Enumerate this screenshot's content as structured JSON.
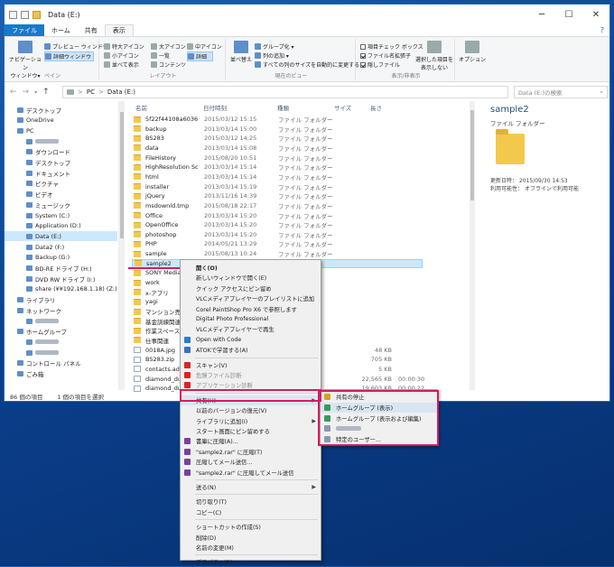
{
  "window": {
    "title": "Data (E:)",
    "controls": {
      "minimize": "─",
      "maximize": "☐",
      "close": "✕"
    }
  },
  "tabs": {
    "file": "ファイル",
    "home": "ホーム",
    "share": "共有",
    "view": "表示"
  },
  "ribbon": {
    "pane": {
      "nav_pane": "ナビゲーション\nウィンドウ▾",
      "preview_pane": "プレビュー ウィンドウ",
      "details_pane": "詳細ウィンドウ",
      "label": "ペイン"
    },
    "layout": {
      "xlarge_icons": "特大アイコン",
      "large_icons": "大アイコン",
      "medium_icons": "中アイコン",
      "small_icons": "小アイコン",
      "list": "一覧",
      "details": "詳細",
      "tiles": "並べて表示",
      "content": "コンテンツ",
      "label": "レイアウト"
    },
    "current_view": {
      "sort": "並べ替え",
      "group_by": "グループ化 ▾",
      "add_columns": "列の追加 ▾",
      "size_all_columns": "すべての列のサイズを自動的に変更する",
      "label": "現在のビュー"
    },
    "show_hide": {
      "item_checkboxes": "項目チェック ボックス",
      "file_extensions": "ファイル名拡張子",
      "hidden_items": "隠しファイル",
      "hide_selected": "選択した項目を\n表示しない",
      "label": "表示/非表示",
      "checked": {
        "item_checkboxes": false,
        "file_extensions": true,
        "hidden_items": true
      }
    },
    "options": "オプション"
  },
  "address": {
    "back": "←",
    "forward": "→",
    "recent": "▾",
    "up": "↑",
    "path": [
      "PC",
      "Data (E:)"
    ],
    "separator": ">",
    "search_placeholder": "Data (E:)の検索"
  },
  "nav": [
    {
      "label": "デスクトップ",
      "indent": 1,
      "icon": "desktop-icon"
    },
    {
      "label": "OneDrive",
      "indent": 1,
      "icon": "onedrive-icon"
    },
    {
      "label": "PC",
      "indent": 1,
      "icon": "pc-icon"
    },
    {
      "label": "",
      "indent": 2,
      "icon": "user-icon",
      "blurred": true
    },
    {
      "label": "ダウンロード",
      "indent": 2,
      "icon": "download-icon"
    },
    {
      "label": "デスクトップ",
      "indent": 2,
      "icon": "desktop-icon"
    },
    {
      "label": "ドキュメント",
      "indent": 2,
      "icon": "documents-icon"
    },
    {
      "label": "ピクチャ",
      "indent": 2,
      "icon": "pictures-icon"
    },
    {
      "label": "ビデオ",
      "indent": 2,
      "icon": "video-icon"
    },
    {
      "label": "ミュージック",
      "indent": 2,
      "icon": "music-icon"
    },
    {
      "label": "System (C:)",
      "indent": 2,
      "icon": "drive-icon"
    },
    {
      "label": "Application (D:)",
      "indent": 2,
      "icon": "drive-icon"
    },
    {
      "label": "Data (E:)",
      "indent": 2,
      "icon": "drive-icon",
      "selected": true
    },
    {
      "label": "Data2 (F:)",
      "indent": 2,
      "icon": "drive-icon"
    },
    {
      "label": "Backup (G:)",
      "indent": 2,
      "icon": "drive-icon"
    },
    {
      "label": "BD-RE ドライブ (H:)",
      "indent": 2,
      "icon": "disc-icon"
    },
    {
      "label": "DVD RW ドライブ (I:)",
      "indent": 2,
      "icon": "disc-icon"
    },
    {
      "label": "share (¥¥192.168.1.18) (Z:)",
      "indent": 2,
      "icon": "network-drive-icon"
    },
    {
      "label": "ライブラリ",
      "indent": 1,
      "icon": "library-icon"
    },
    {
      "label": "ネットワーク",
      "indent": 1,
      "icon": "network-icon"
    },
    {
      "label": "",
      "indent": 2,
      "icon": "computer-icon",
      "blurred": true
    },
    {
      "label": "ホームグループ",
      "indent": 1,
      "icon": "homegroup-icon"
    },
    {
      "label": "",
      "indent": 2,
      "icon": "user-icon",
      "blurred": true
    },
    {
      "label": "",
      "indent": 2,
      "icon": "user-icon",
      "blurred": true
    },
    {
      "label": "コントロール パネル",
      "indent": 1,
      "icon": "control-panel-icon"
    },
    {
      "label": "ごみ箱",
      "indent": 1,
      "icon": "recycle-bin-icon"
    }
  ],
  "columns": {
    "name": "名前",
    "date": "日付時刻",
    "type": "種類",
    "size": "サイズ",
    "length": "長さ"
  },
  "files": [
    {
      "name": "5f22f44108a6036bb...",
      "date": "2015/03/12 15:15",
      "type": "ファイル フォルダー",
      "size": ""
    },
    {
      "name": "backup",
      "date": "2013/03/14 15:00",
      "type": "ファイル フォルダー",
      "size": ""
    },
    {
      "name": "BS283",
      "date": "2015/03/12 14:25",
      "type": "ファイル フォルダー",
      "size": ""
    },
    {
      "name": "data",
      "date": "2013/03/14 15:08",
      "type": "ファイル フォルダー",
      "size": ""
    },
    {
      "name": "FileHistory",
      "date": "2015/08/20 10:51",
      "type": "ファイル フォルダー",
      "size": ""
    },
    {
      "name": "HighResolution Sou...",
      "date": "2013/03/14 15:14",
      "type": "ファイル フォルダー",
      "size": ""
    },
    {
      "name": "html",
      "date": "2013/03/14 15:14",
      "type": "ファイル フォルダー",
      "size": ""
    },
    {
      "name": "installer",
      "date": "2013/03/14 15:19",
      "type": "ファイル フォルダー",
      "size": ""
    },
    {
      "name": "jQuery",
      "date": "2013/11/16 14:39",
      "type": "ファイル フォルダー",
      "size": ""
    },
    {
      "name": "msdownld.tmp",
      "date": "2015/08/18 22:17",
      "type": "ファイル フォルダー",
      "size": ""
    },
    {
      "name": "Office",
      "date": "2013/03/14 15:20",
      "type": "ファイル フォルダー",
      "size": ""
    },
    {
      "name": "OpenOffice",
      "date": "2013/03/14 15:20",
      "type": "ファイル フォルダー",
      "size": ""
    },
    {
      "name": "photoshop",
      "date": "2013/03/14 15:20",
      "type": "ファイル フォルダー",
      "size": ""
    },
    {
      "name": "PHP",
      "date": "2014/05/21 13:29",
      "type": "ファイル フォルダー",
      "size": ""
    },
    {
      "name": "sample",
      "date": "2015/08/13 10:24",
      "type": "ファイル フォルダー",
      "size": ""
    },
    {
      "name": "sample2",
      "date": "",
      "type": "",
      "size": "",
      "selected": true
    },
    {
      "name": "SONY MediaPla...",
      "date": "",
      "type": "",
      "size": ""
    },
    {
      "name": "work",
      "date": "",
      "type": "",
      "size": ""
    },
    {
      "name": "x-アプリ",
      "date": "",
      "type": "",
      "size": ""
    },
    {
      "name": "yagi",
      "date": "",
      "type": "",
      "size": ""
    },
    {
      "name": "マンション売却関連",
      "date": "",
      "type": "",
      "size": ""
    },
    {
      "name": "基金訓練関連",
      "date": "",
      "type": "",
      "size": ""
    },
    {
      "name": "作業スペース",
      "date": "",
      "type": "",
      "size": ""
    },
    {
      "name": "仕事関連",
      "date": "",
      "type": "",
      "size": ""
    },
    {
      "name": "0018A.jpg",
      "date": "",
      "type": "",
      "size": "48 KB",
      "file": true
    },
    {
      "name": "BS283.zip",
      "date": "",
      "type": "",
      "size": "705 KB",
      "file": true
    },
    {
      "name": "contacts.adr",
      "date": "",
      "type": "",
      "size": "5 KB",
      "file": true
    },
    {
      "name": "diamond_dust20...",
      "date": "",
      "type": "",
      "size": "22,565 KB",
      "length": "00:00:30",
      "file": true
    },
    {
      "name": "diamond_dust3...",
      "date": "",
      "type": "",
      "size": "19,603 KB",
      "length": "00:00:22",
      "file": true
    }
  ],
  "preview": {
    "name": "sample2",
    "type": "ファイル フォルダー",
    "modified_label": "更新日時：",
    "modified": "2015/09/30 14:53",
    "availability_label": "利用可能性：",
    "availability": "オフラインで利用可能"
  },
  "status": {
    "count": "86 個の項目",
    "selected": "1 個の項目を選択"
  },
  "context_menu": [
    {
      "label": "開く(O)",
      "bold": true
    },
    {
      "label": "新しいウィンドウで開く(E)"
    },
    {
      "label": "クイック アクセスにピン留め"
    },
    {
      "label": "VLCメディアプレイヤーのプレイリストに追加"
    },
    {
      "label": "Corel PaintShop Pro X6 で参照します"
    },
    {
      "label": "Digital Photo Professional"
    },
    {
      "label": "VLCメディアプレイヤーで再生"
    },
    {
      "label": "Open with Code",
      "icon": "vscode-icon"
    },
    {
      "label": "ATOKで学習する(A)",
      "icon": "atok-icon"
    },
    {
      "sep": true
    },
    {
      "label": "スキャン(V)",
      "icon": "antivirus-icon"
    },
    {
      "label": "危険ファイル診断",
      "icon": "antivirus-icon",
      "disabled": true
    },
    {
      "label": "アプリケーション診断",
      "icon": "antivirus-icon",
      "disabled": true
    },
    {
      "sep": true
    },
    {
      "label": "共有(H)",
      "submenu": true,
      "highlighted": true
    },
    {
      "label": "以前のバージョンの復元(V)"
    },
    {
      "label": "ライブラリに追加(I)",
      "submenu": true
    },
    {
      "label": "スタート画面にピン留めする"
    },
    {
      "label": "書庫に圧縮(A)...",
      "icon": "archive-icon"
    },
    {
      "label": "\"sample2.rar\" に圧縮(T)",
      "icon": "archive-icon"
    },
    {
      "label": "圧縮してメール送信...",
      "icon": "archive-icon"
    },
    {
      "label": "\"sample2.rar\" に圧縮してメール送信",
      "icon": "archive-icon"
    },
    {
      "sep": true
    },
    {
      "label": "送る(N)",
      "submenu": true
    },
    {
      "sep": true
    },
    {
      "label": "切り取り(T)"
    },
    {
      "label": "コピー(C)"
    },
    {
      "sep": true
    },
    {
      "label": "ショートカットの作成(S)"
    },
    {
      "label": "削除(D)"
    },
    {
      "label": "名前の変更(M)"
    },
    {
      "sep": true
    },
    {
      "label": "プロパティ(R)"
    }
  ],
  "share_submenu": [
    {
      "label": "共有の停止",
      "icon": "lock-icon"
    },
    {
      "label": "ホームグループ (表示)",
      "icon": "homegroup-icon",
      "highlighted": true
    },
    {
      "label": "ホームグループ (表示および編集)",
      "icon": "homegroup-icon"
    },
    {
      "label": "",
      "icon": "user-icon",
      "blurred": true
    },
    {
      "label": "特定のユーザー...",
      "icon": "users-icon"
    }
  ],
  "colors": {
    "accent": "#1979ca",
    "highlight_border": "#d81b60",
    "selection": "#cce8ff",
    "folder": "#f2c94c"
  }
}
